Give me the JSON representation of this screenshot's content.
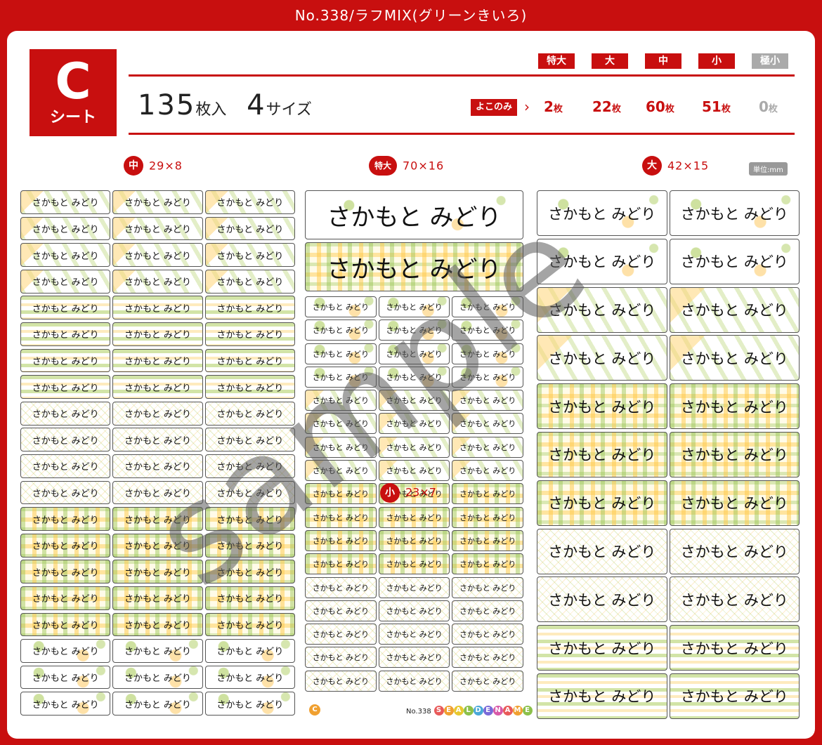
{
  "header": {
    "title": "No.338/ラフMIX(グリーンきいろ)"
  },
  "sheet": {
    "letter": "C",
    "label": "シート"
  },
  "summary": {
    "count": "135",
    "count_unit": "枚入",
    "sizes": "4",
    "sizes_unit": "サイズ"
  },
  "sizes": [
    {
      "name": "特大",
      "qty": "2",
      "active": true
    },
    {
      "name": "大",
      "qty": "22",
      "active": true
    },
    {
      "name": "中",
      "qty": "60",
      "active": true
    },
    {
      "name": "小",
      "qty": "51",
      "active": true
    },
    {
      "name": "極小",
      "qty": "0",
      "active": false
    }
  ],
  "qty_unit": "枚",
  "yoko_label": "よこのみ",
  "sections": {
    "chu": {
      "badge": "中",
      "dim": "29×8"
    },
    "tokudai": {
      "badge": "特大",
      "dim": "70×16"
    },
    "dai": {
      "badge": "大",
      "dim": "42×15"
    },
    "sho": {
      "badge": "小",
      "dim": "23×7"
    }
  },
  "unit_label": "単位:mm",
  "label_name": "さかもと みどり",
  "watermark": "sample",
  "footer": {
    "c_mark": "C",
    "number": "No.338",
    "brand": "SEALDENAME"
  },
  "colors": {
    "brand_red": "#c80f0f",
    "green": "#adcd5f",
    "yellow": "#fdd36e"
  }
}
